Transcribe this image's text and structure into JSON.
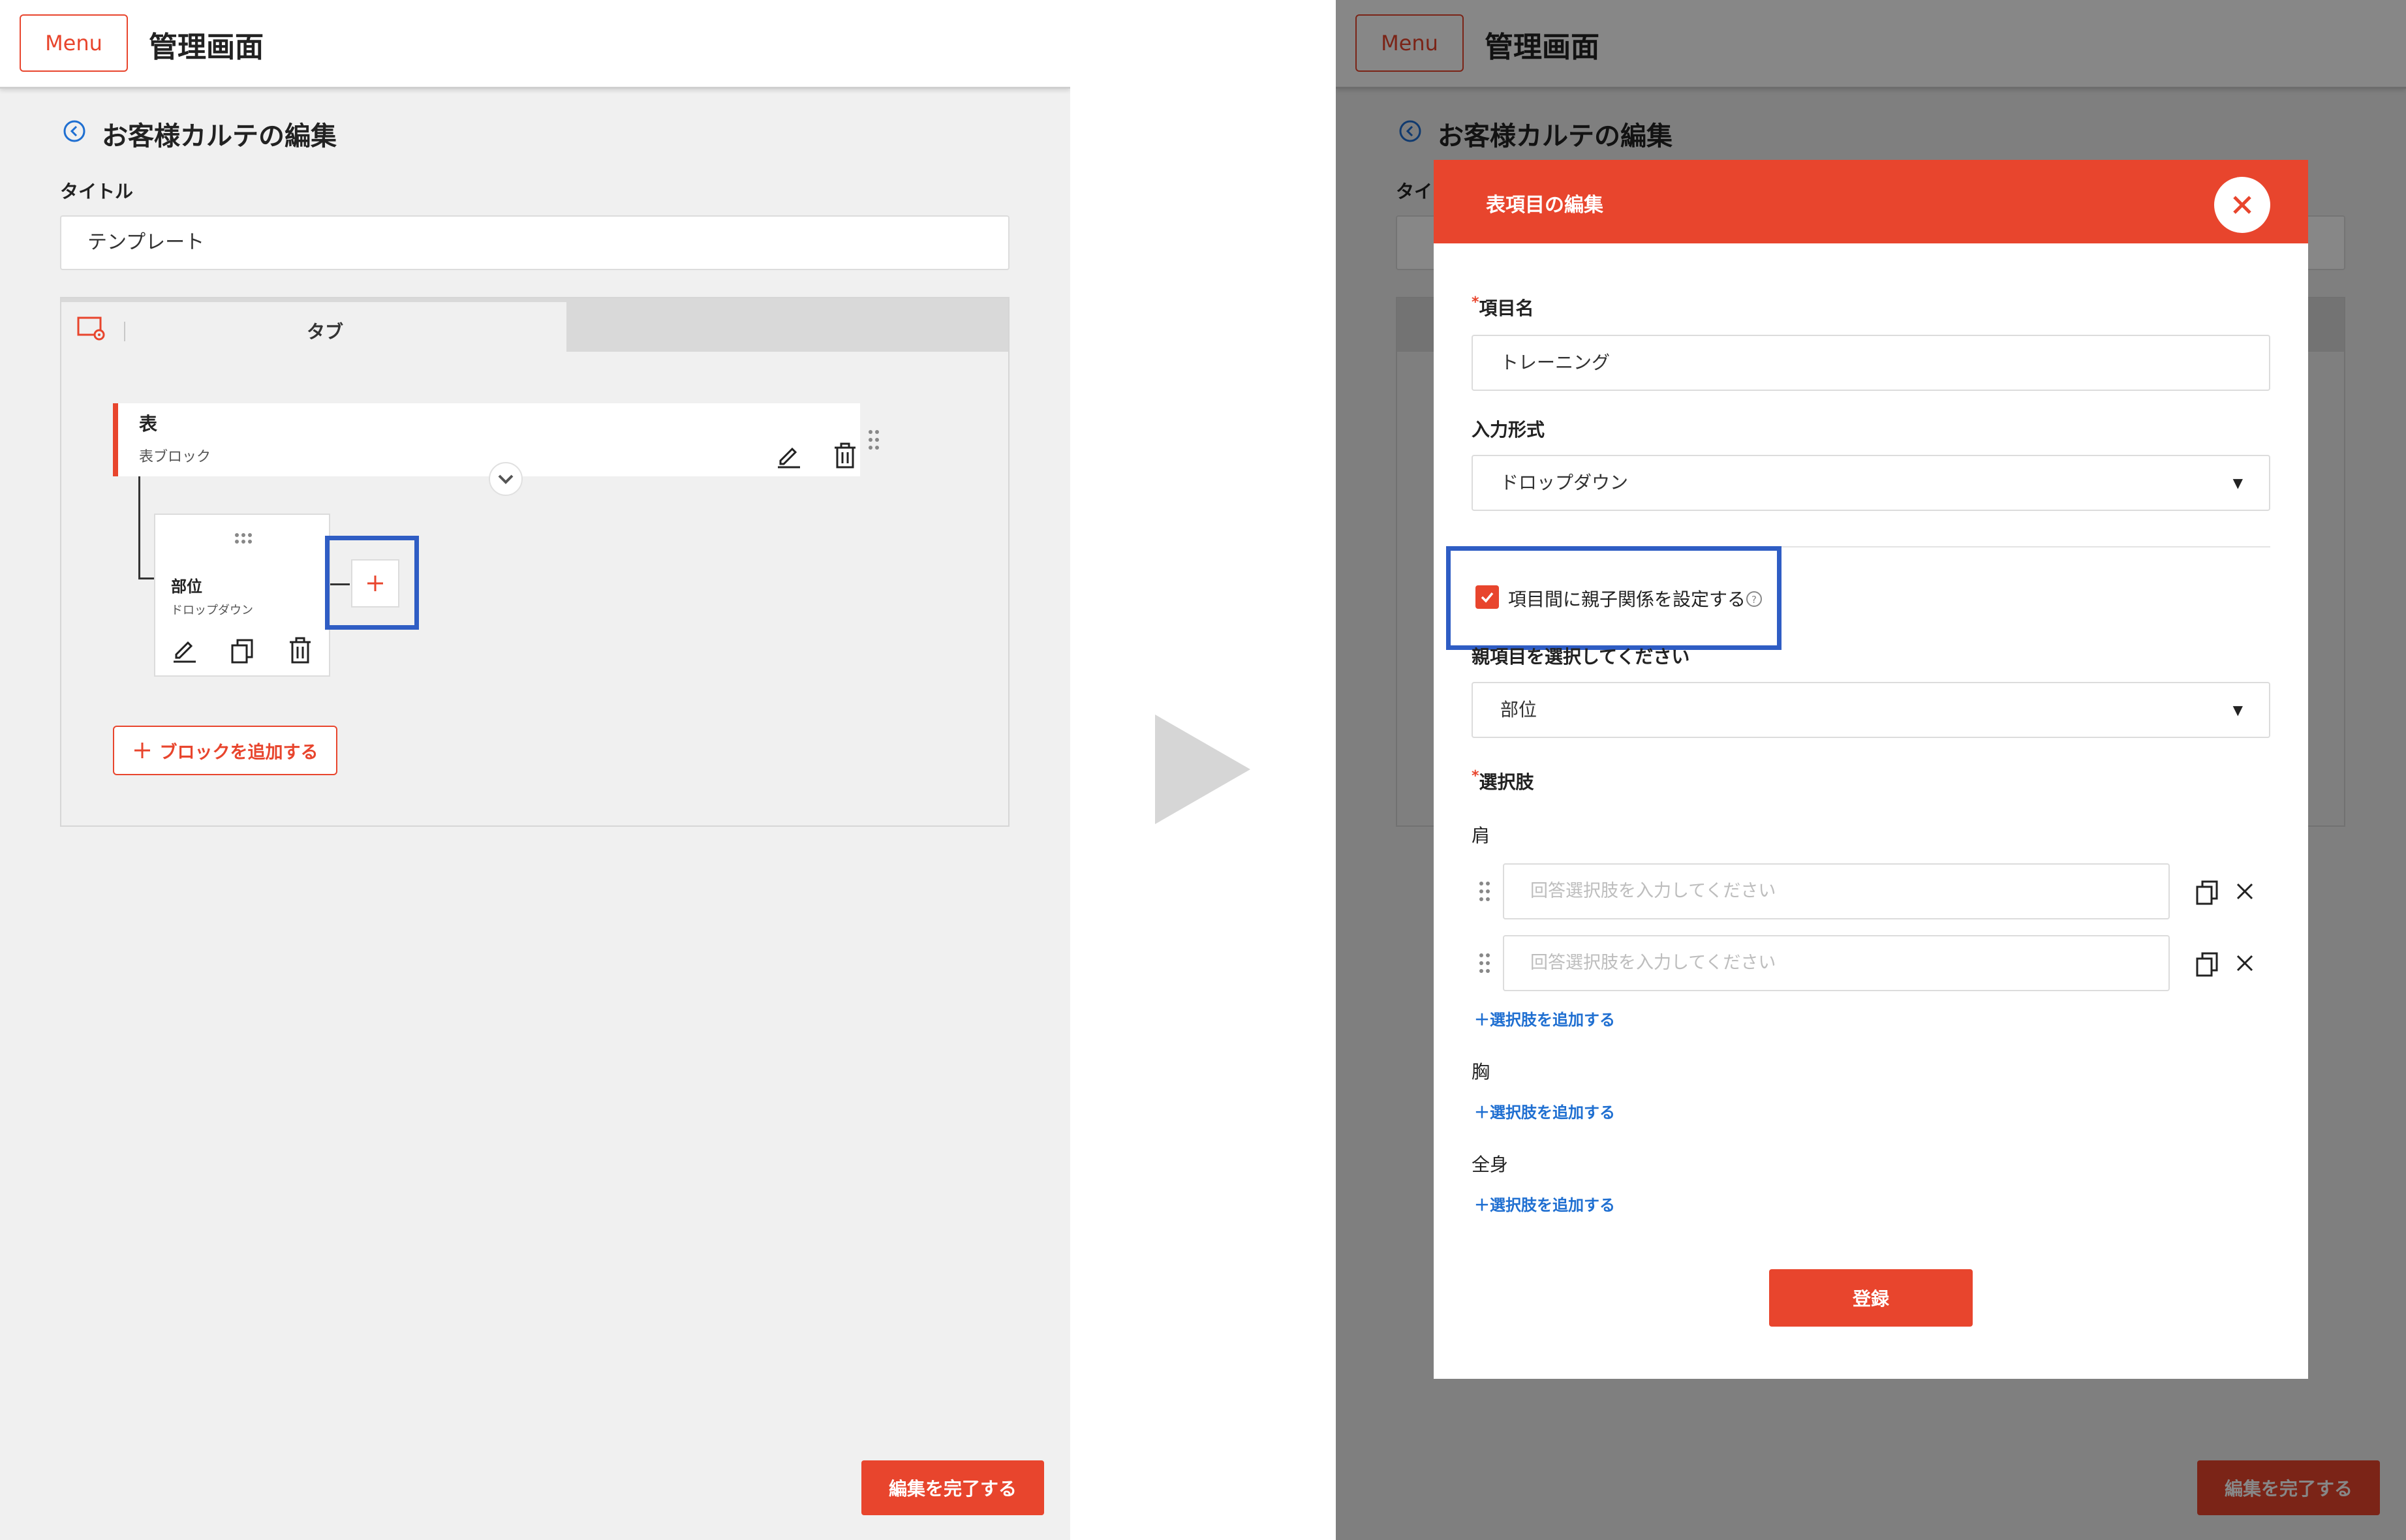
{
  "left": {
    "menu_label": "Menu",
    "header_title": "管理画面",
    "page_title": "お客様カルテの編集",
    "title_field_label": "タイトル",
    "title_value": "テンプレート",
    "tab_label": "タブ",
    "block": {
      "name": "表",
      "type": "表ブロック"
    },
    "field": {
      "name": "部位",
      "type": "ドロップダウン"
    },
    "add_block_label": "ブロックを追加する",
    "finish_label": "編集を完了する"
  },
  "right": {
    "menu_label": "Menu",
    "header_title": "管理画面",
    "page_title": "お客様カルテの編集",
    "title_field_label_partial": "タイ",
    "finish_label": "編集を完了する",
    "modal": {
      "title": "表項目の編集",
      "item_name_label": "項目名",
      "item_name_value": "トレーニング",
      "input_type_label": "入力形式",
      "input_type_value": "ドロップダウン",
      "parent_checkbox_label": "項目間に親子関係を設定する",
      "parent_checkbox_checked": true,
      "parent_select_label": "親項目を選択してください",
      "parent_select_value": "部位",
      "choices_label": "選択肢",
      "required_mark": "*",
      "groups": [
        {
          "name": "肩",
          "inputs": [
            {
              "placeholder": "回答選択肢を入力してください"
            },
            {
              "placeholder": "回答選択肢を入力してください"
            }
          ]
        },
        {
          "name": "胸",
          "inputs": []
        },
        {
          "name": "全身",
          "inputs": []
        }
      ],
      "add_choice_label": "選択肢を追加する",
      "submit_label": "登録"
    }
  },
  "colors": {
    "accent": "#e8452d",
    "highlight": "#2f5dc4",
    "link": "#1f6fd1"
  }
}
